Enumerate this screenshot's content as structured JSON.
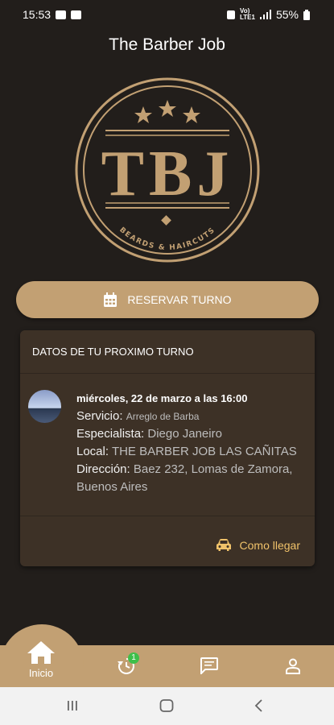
{
  "status_bar": {
    "time": "15:53",
    "battery": "55%",
    "net_top": "Vo)",
    "net_bottom": "LTE1"
  },
  "header": {
    "title": "The Barber Job"
  },
  "logo": {
    "letters": "TBJ",
    "tagline": "BEARDS & HAIRCUTS"
  },
  "reserve": {
    "label": "RESERVAR TURNO"
  },
  "appointment": {
    "heading": "DATOS DE TU PROXIMO TURNO",
    "date": "miércoles, 22 de marzo a las 16:00",
    "service_label": "Servicio:",
    "service_value": "Arreglo de Barba",
    "specialist_label": "Especialista:",
    "specialist_value": "Diego Janeiro",
    "local_label": "Local:",
    "local_value": "THE BARBER JOB LAS CAÑITAS",
    "address_label": "Dirección:",
    "address_value": "Baez 232, Lomas de Zamora,  Buenos Aires",
    "directions_label": "Como llegar"
  },
  "nav": {
    "home_label": "Inicio",
    "history_badge": "1"
  },
  "colors": {
    "background": "#221e1b",
    "accent": "#c2a073",
    "card": "#3d3126",
    "link": "#f0c26a"
  }
}
